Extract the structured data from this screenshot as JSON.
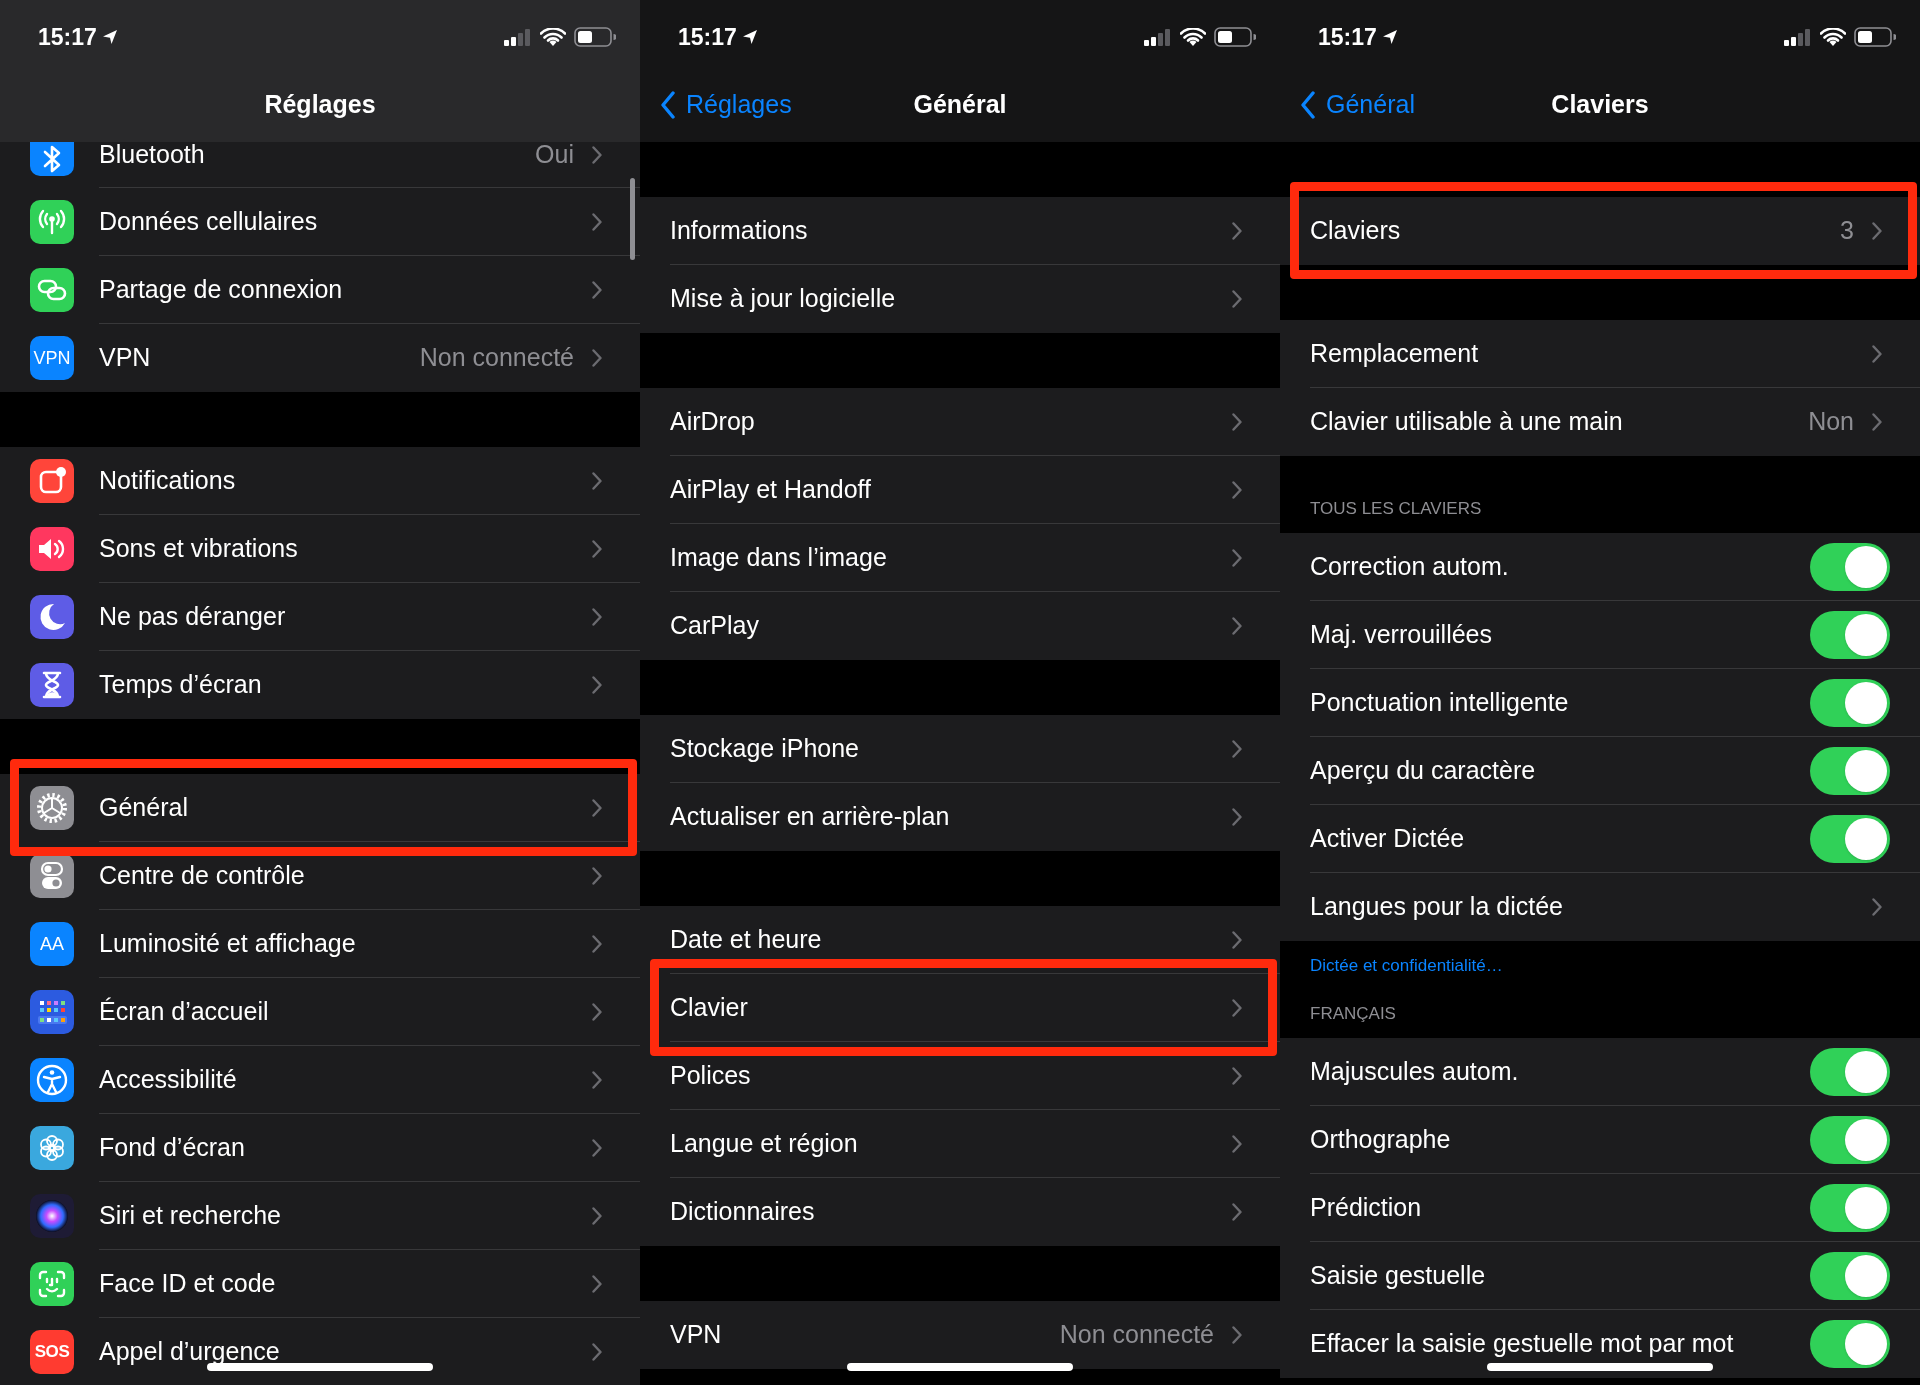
{
  "panels": [
    {
      "status_bar": {
        "time": "15:17"
      },
      "nav": {
        "title": "Réglages"
      },
      "scroll_indicator": true,
      "sections": [
        {
          "rows": [
            {
              "kind": "link",
              "label": "Bluetooth",
              "value": "Oui",
              "color": "#0a84ff",
              "highlighted": false
            },
            {
              "kind": "link",
              "label": "Données cellulaires",
              "color": "#30d158",
              "highlighted": false
            },
            {
              "kind": "link",
              "label": "Partage de connexion",
              "color": "#30d158",
              "highlighted": false
            },
            {
              "kind": "link",
              "label": "VPN",
              "value": "Non connecté",
              "color": "#0a84ff",
              "icon_text": "VPN",
              "highlighted": false
            }
          ]
        },
        {
          "rows": [
            {
              "kind": "link",
              "label": "Notifications",
              "color": "#ff453a",
              "highlighted": false
            },
            {
              "kind": "link",
              "label": "Sons et vibrations",
              "color": "#ff375f",
              "highlighted": false
            },
            {
              "kind": "link",
              "label": "Ne pas déranger",
              "color": "#5e5ce6",
              "highlighted": false
            },
            {
              "kind": "link",
              "label": "Temps d’écran",
              "color": "#5e5ce6",
              "highlighted": false
            }
          ]
        },
        {
          "rows": [
            {
              "kind": "link",
              "label": "Général",
              "color": "#8e8e93",
              "highlighted": true
            },
            {
              "kind": "link",
              "label": "Centre de contrôle",
              "color": "#8e8e93",
              "highlighted": false
            },
            {
              "kind": "link",
              "label": "Luminosité et affichage",
              "color": "#0a84ff",
              "icon_text": "AA",
              "highlighted": false
            },
            {
              "kind": "link",
              "label": "Écran d’accueil",
              "color": "#2c5be0",
              "highlighted": false
            },
            {
              "kind": "link",
              "label": "Accessibilité",
              "color": "#0a84ff",
              "highlighted": false
            },
            {
              "kind": "link",
              "label": "Fond d’écran",
              "color": "#3aa8de",
              "highlighted": false
            },
            {
              "kind": "link",
              "label": "Siri et recherche",
              "color": "#1e1b35",
              "highlighted": false
            },
            {
              "kind": "link",
              "label": "Face ID et code",
              "color": "#30d158",
              "highlighted": false
            },
            {
              "kind": "link",
              "label": "Appel d’urgence",
              "color": "#ff3b30",
              "icon_text": "SOS",
              "highlighted": false
            }
          ]
        }
      ]
    },
    {
      "status_bar": {
        "time": "15:17"
      },
      "nav": {
        "back": "Réglages",
        "title": "Général"
      },
      "scroll_indicator": false,
      "sections": [
        {
          "rows": [
            {
              "kind": "link",
              "label": "Informations",
              "highlighted": false
            },
            {
              "kind": "link",
              "label": "Mise à jour logicielle",
              "highlighted": false
            }
          ]
        },
        {
          "rows": [
            {
              "kind": "link",
              "label": "AirDrop",
              "highlighted": false
            },
            {
              "kind": "link",
              "label": "AirPlay et Handoff",
              "highlighted": false
            },
            {
              "kind": "link",
              "label": "Image dans l’image",
              "highlighted": false
            },
            {
              "kind": "link",
              "label": "CarPlay",
              "highlighted": false
            }
          ]
        },
        {
          "rows": [
            {
              "kind": "link",
              "label": "Stockage iPhone",
              "highlighted": false
            },
            {
              "kind": "link",
              "label": "Actualiser en arrière-plan",
              "highlighted": false
            }
          ]
        },
        {
          "rows": [
            {
              "kind": "link",
              "label": "Date et heure",
              "highlighted": false
            },
            {
              "kind": "link",
              "label": "Clavier",
              "highlighted": true
            },
            {
              "kind": "link",
              "label": "Polices",
              "highlighted": false
            },
            {
              "kind": "link",
              "label": "Langue et région",
              "highlighted": false
            },
            {
              "kind": "link",
              "label": "Dictionnaires",
              "highlighted": false
            }
          ]
        },
        {
          "rows": [
            {
              "kind": "link",
              "label": "VPN",
              "value": "Non connecté",
              "highlighted": false
            }
          ]
        }
      ]
    },
    {
      "status_bar": {
        "time": "15:17"
      },
      "nav": {
        "back": "Général",
        "title": "Claviers"
      },
      "scroll_indicator": false,
      "sections": [
        {
          "rows": [
            {
              "kind": "link",
              "label": "Claviers",
              "value": "3",
              "highlighted": true
            }
          ]
        },
        {
          "rows": [
            {
              "kind": "link",
              "label": "Remplacement",
              "highlighted": false
            },
            {
              "kind": "link",
              "label": "Clavier utilisable à une main",
              "value": "Non",
              "highlighted": false
            }
          ]
        },
        {
          "header": "TOUS LES CLAVIERS",
          "footer": "Dictée et confidentialité…",
          "rows": [
            {
              "kind": "toggle",
              "label": "Correction autom.",
              "on": true,
              "highlighted": false
            },
            {
              "kind": "toggle",
              "label": "Maj. verrouillées",
              "on": true,
              "highlighted": false
            },
            {
              "kind": "toggle",
              "label": "Ponctuation intelligente",
              "on": true,
              "highlighted": false
            },
            {
              "kind": "toggle",
              "label": "Aperçu du caractère",
              "on": true,
              "highlighted": false
            },
            {
              "kind": "toggle",
              "label": "Activer Dictée",
              "on": true,
              "highlighted": false
            },
            {
              "kind": "link",
              "label": "Langues pour la dictée",
              "highlighted": false
            }
          ]
        },
        {
          "header": "FRANÇAIS",
          "rows": [
            {
              "kind": "toggle",
              "label": "Majuscules autom.",
              "on": true,
              "highlighted": false
            },
            {
              "kind": "toggle",
              "label": "Orthographe",
              "on": true,
              "highlighted": false
            },
            {
              "kind": "toggle",
              "label": "Prédiction",
              "on": true,
              "highlighted": false
            },
            {
              "kind": "toggle",
              "label": "Saisie gestuelle",
              "on": true,
              "highlighted": false
            },
            {
              "kind": "toggle",
              "label": "Effacer la saisie gestuelle mot par mot",
              "on": true,
              "highlighted": false
            }
          ]
        }
      ]
    }
  ]
}
